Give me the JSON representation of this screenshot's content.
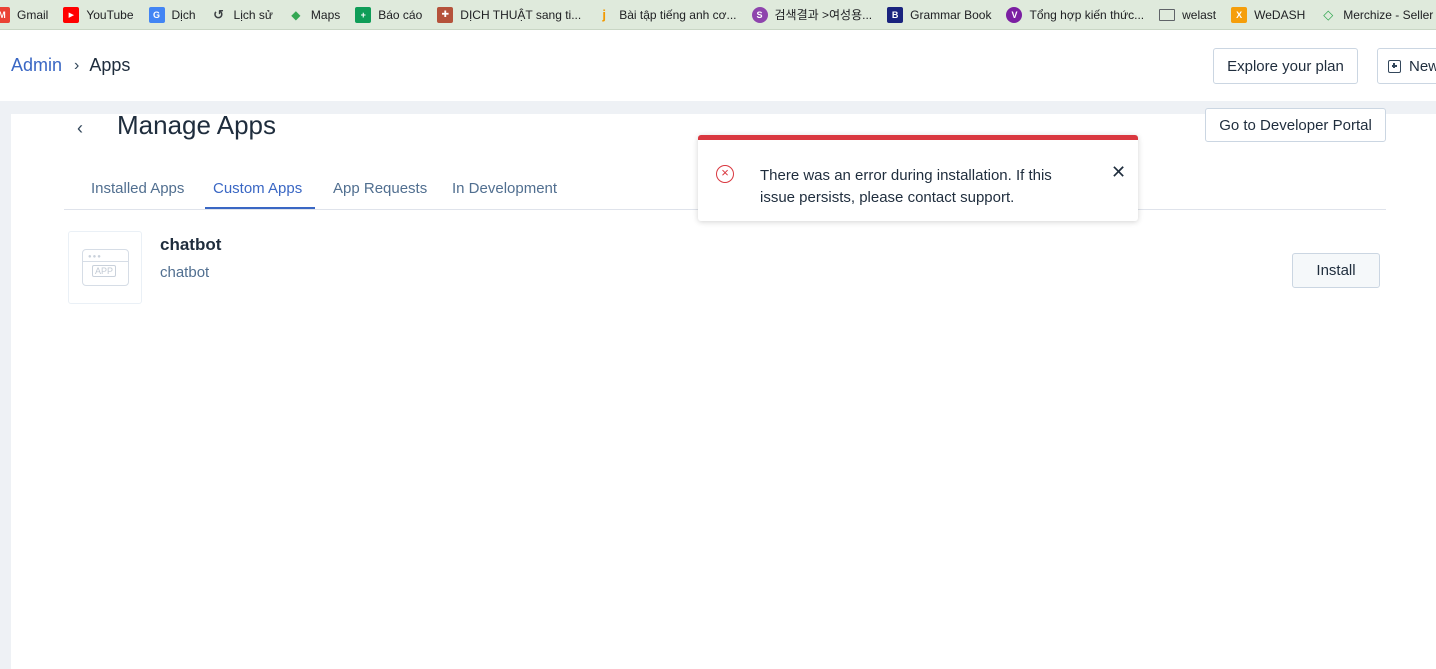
{
  "bookmarks": [
    {
      "label": "Gmail",
      "icon": "gmail-icon",
      "color": "#ea4335",
      "glyph": "M"
    },
    {
      "label": "YouTube",
      "icon": "youtube-icon",
      "color": "#ff0000",
      "glyph": "▶"
    },
    {
      "label": "Dịch",
      "icon": "translate-icon",
      "color": "#4285f4",
      "glyph": "G"
    },
    {
      "label": "Lịch sử",
      "icon": "history-icon",
      "color": "#5f6368",
      "glyph": "↺"
    },
    {
      "label": "Maps",
      "icon": "maps-icon",
      "color": "#34a853",
      "glyph": "◆"
    },
    {
      "label": "Báo cáo",
      "icon": "sheets-icon",
      "color": "#0f9d58",
      "glyph": "+"
    },
    {
      "label": "DỊCH THUẬT sang ti...",
      "icon": "crest-icon",
      "color": "#b5523b",
      "glyph": "✚"
    },
    {
      "label": "Bài tập tiếng anh cơ...",
      "icon": "j-icon",
      "color": "#f29900",
      "glyph": "j"
    },
    {
      "label": "검색결과 >여성용...",
      "icon": "ssg-icon",
      "color": "#8e44ad",
      "glyph": "S"
    },
    {
      "label": "Grammar Book",
      "icon": "book-icon",
      "color": "#1a237e",
      "glyph": "B"
    },
    {
      "label": "Tổng hợp kiến thức...",
      "icon": "vtb-icon",
      "color": "#7b1fa2",
      "glyph": "V"
    },
    {
      "label": "welast",
      "icon": "folder-icon",
      "color": "#5f6368",
      "glyph": "▭"
    },
    {
      "label": "WeDASH",
      "icon": "wedash-icon",
      "color": "#f59e0b",
      "glyph": "X"
    },
    {
      "label": "Merchize - Seller",
      "icon": "merchize-icon",
      "color": "#34a853",
      "glyph": "◇"
    }
  ],
  "breadcrumb": {
    "parent": "Admin",
    "current": "Apps"
  },
  "header_buttons": {
    "explore": "Explore your plan",
    "new": "New"
  },
  "page": {
    "title": "Manage Apps",
    "developer_portal": "Go to Developer Portal"
  },
  "tabs": [
    "Installed Apps",
    "Custom Apps",
    "App Requests",
    "In Development"
  ],
  "active_tab": "Custom Apps",
  "apps": [
    {
      "name": "chatbot",
      "description": "chatbot",
      "thumb_label": "APP",
      "action": "Install"
    }
  ],
  "toast": {
    "type": "error",
    "message": "There was an error during installation. If this issue persists, please contact support.",
    "accent_color": "#d9373f"
  }
}
